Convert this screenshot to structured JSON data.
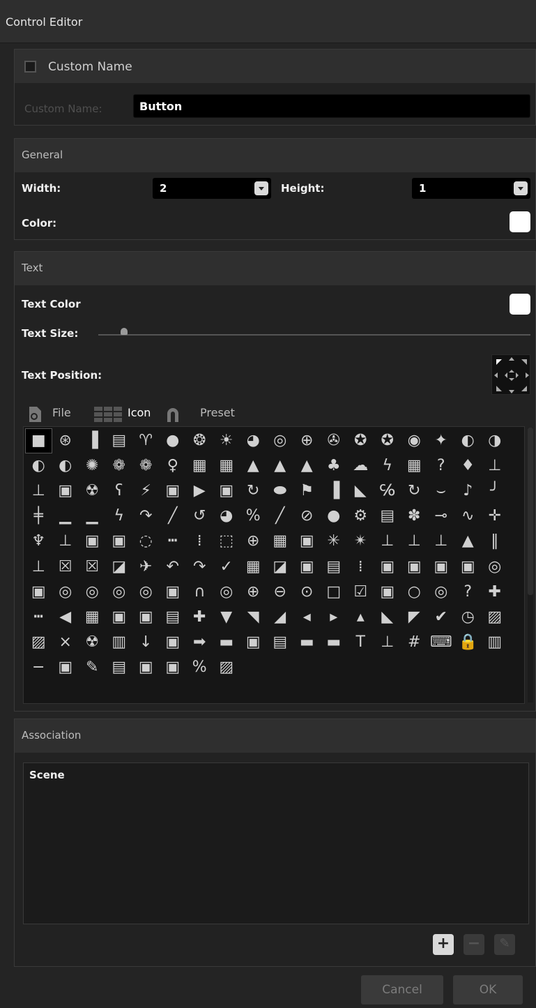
{
  "window": {
    "title": "Control Editor"
  },
  "custom_name": {
    "checkbox_label": "Custom Name",
    "checked": false,
    "field_label": "Custom Name:",
    "value": "Button"
  },
  "general": {
    "header": "General",
    "width_label": "Width:",
    "width_value": "2",
    "height_label": "Height:",
    "height_value": "1",
    "color_label": "Color:",
    "color_value": "#ffffff"
  },
  "text": {
    "header": "Text",
    "text_color_label": "Text Color",
    "text_color_value": "#ffffff",
    "text_size_label": "Text Size:",
    "text_size_level": 0.05,
    "text_position_label": "Text Position:",
    "tabs": [
      {
        "label": "File",
        "icon": "file-icon"
      },
      {
        "label": "Icon",
        "icon": "grid-icon",
        "active": true
      },
      {
        "label": "Preset",
        "icon": "magnet-icon"
      }
    ],
    "icons": [
      "■",
      "⊛",
      "▐",
      "▤",
      "♈",
      "●",
      "❂",
      "☀",
      "◕",
      "◎",
      "⊕",
      "✇",
      "✪",
      "✪",
      "◉",
      "✦",
      "◐",
      "◑",
      "◐",
      "◐",
      "✺",
      "❁",
      "❁",
      "♀",
      "▦",
      "▦",
      "▲",
      "▲",
      "▲",
      "♣",
      "☁",
      "ϟ",
      "▦",
      "?",
      "♦",
      "⊥",
      "⊥",
      "▣",
      "☢",
      "ʕ",
      "⚡",
      "▣",
      "▶",
      "▣",
      "↻",
      "⬬",
      "⚑",
      "▐",
      "◣",
      "℅",
      "↻",
      "⌣",
      "♪",
      "╯",
      "╪",
      "▁",
      "▁",
      "ϟ",
      "↷",
      "╱",
      "↺",
      "◕",
      "%",
      "╱",
      "⊘",
      "●",
      "⚙",
      "▤",
      "✽",
      "⊸",
      "∿",
      "✛",
      "♆",
      "⊥",
      "▣",
      "▣",
      "◌",
      "┅",
      "⁞",
      "⬚",
      "⊕",
      "▦",
      "▣",
      "✳",
      "✴",
      "⊥",
      "⊥",
      "⊥",
      "▲",
      "‖",
      "⊥",
      "☒",
      "☒",
      "◪",
      "✈",
      "↶",
      "↷",
      "✓",
      "▦",
      "◪",
      "▣",
      "▤",
      "⁞",
      "▣",
      "▣",
      "▣",
      "▣",
      "◎",
      "▣",
      "◎",
      "◎",
      "◎",
      "◎",
      "▣",
      "∩",
      "◎",
      "⊕",
      "⊖",
      "⊙",
      "□",
      "☑",
      "▣",
      "○",
      "◎",
      "?",
      "✚",
      "┅",
      "◀",
      "▦",
      "▣",
      "▣",
      "▤",
      "✚",
      "▼",
      "◥",
      "◢",
      "◂",
      "▸",
      "▴",
      "◣",
      "◤",
      "✔",
      "◷",
      "▨",
      "▨",
      "×",
      "☢",
      "▥",
      "↓",
      "▣",
      "➡",
      "▬",
      "▣",
      "▤",
      "▬",
      "▬",
      "T",
      "⊥",
      "#",
      "⌨",
      "🔒",
      "▥",
      "−",
      "▣",
      "✎",
      "▤",
      "▣",
      "▣",
      "%",
      "▨"
    ]
  },
  "association": {
    "header": "Association",
    "items": [
      "Scene"
    ],
    "add_symbol": "+",
    "remove_symbol": "−",
    "edit_symbol": "✎"
  },
  "buttons": {
    "cancel": "Cancel",
    "ok": "OK"
  }
}
